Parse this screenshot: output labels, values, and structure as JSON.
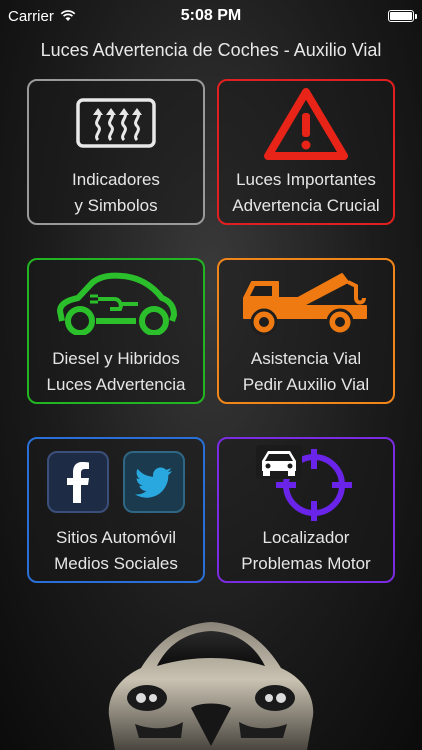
{
  "status_bar": {
    "carrier": "Carrier",
    "time": "5:08 PM"
  },
  "app_title": "Luces Advertencia de Coches - Auxilio Vial",
  "tiles": [
    {
      "line1": "Indicadores",
      "line2": "y Simbolos",
      "border_color": "#9a9a9a",
      "icon": "defroster-icon"
    },
    {
      "line1": "Luces Importantes",
      "line2": "Advertencia Crucial",
      "border_color": "#e02020",
      "icon": "warning-triangle-icon"
    },
    {
      "line1": "Diesel y Hibridos",
      "line2": "Luces Advertencia",
      "border_color": "#22b522",
      "icon": "electric-car-icon"
    },
    {
      "line1": "Asistencia Vial",
      "line2": "Pedir Auxilio Vial",
      "border_color": "#f0851a",
      "icon": "tow-truck-icon"
    },
    {
      "line1": "Sitios Automóvil",
      "line2": "Medios Sociales",
      "border_color": "#2a6fd6",
      "icon": "social-icons"
    },
    {
      "line1": "Localizador",
      "line2": "Problemas Motor",
      "border_color": "#7b2be0",
      "icon": "car-target-icon"
    }
  ]
}
